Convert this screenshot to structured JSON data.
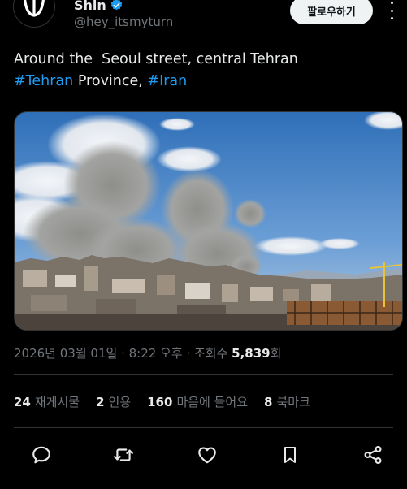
{
  "author": {
    "display_name": "Shin",
    "handle": "@hey_itsmyturn",
    "avatar_icon": "hebrew-shin-letter-icon",
    "verified_color": "#1d9bf0"
  },
  "follow_button": {
    "label": "팔로우하기"
  },
  "tweet": {
    "line1": "Around the  Seoul street, central Tehran",
    "hashtag1": "#Tehran",
    "province": " Province, ",
    "hashtag2": "#Iran"
  },
  "media": {
    "description_icon": "photo-smoke-over-city"
  },
  "meta": {
    "date": "2026년 03월 01일",
    "time": "8:22 오후",
    "separator": " · ",
    "views_label": "조회수 ",
    "views_count": "5,839",
    "views_suffix": "회"
  },
  "stats": {
    "reposts_count": "24",
    "reposts_label": "재게시물",
    "quotes_count": "2",
    "quotes_label": "인용",
    "likes_count": "160",
    "likes_label": "마음에 들어요",
    "bookmarks_count": "8",
    "bookmarks_label": "북마크"
  },
  "colors": {
    "background": "#000000",
    "text": "#e7e9ea",
    "muted": "#71767b",
    "link": "#1d9bf0",
    "divider": "#2f3336"
  }
}
